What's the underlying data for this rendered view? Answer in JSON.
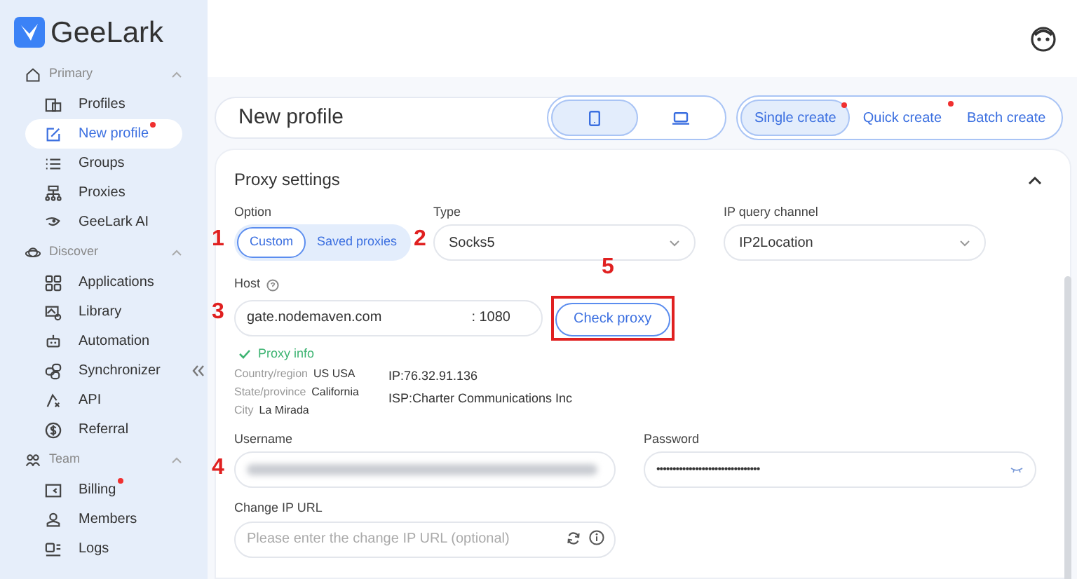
{
  "app": {
    "name": "GeeLark"
  },
  "sidebar": {
    "sections": [
      {
        "title": "Primary",
        "expanded": true,
        "items": [
          {
            "label": "Profiles",
            "selected": false,
            "dot": false
          },
          {
            "label": "New profile",
            "selected": true,
            "dot": true
          },
          {
            "label": "Groups",
            "selected": false,
            "dot": false
          },
          {
            "label": "Proxies",
            "selected": false,
            "dot": false
          },
          {
            "label": "GeeLark AI",
            "selected": false,
            "dot": false
          }
        ]
      },
      {
        "title": "Discover",
        "expanded": true,
        "items": [
          {
            "label": "Applications",
            "selected": false,
            "dot": false
          },
          {
            "label": "Library",
            "selected": false,
            "dot": false
          },
          {
            "label": "Automation",
            "selected": false,
            "dot": false
          },
          {
            "label": "Synchronizer",
            "selected": false,
            "dot": false
          },
          {
            "label": "API",
            "selected": false,
            "dot": false
          },
          {
            "label": "Referral",
            "selected": false,
            "dot": false
          }
        ]
      },
      {
        "title": "Team",
        "expanded": true,
        "items": [
          {
            "label": "Billing",
            "selected": false,
            "dot": true
          },
          {
            "label": "Members",
            "selected": false,
            "dot": false
          },
          {
            "label": "Logs",
            "selected": false,
            "dot": false
          }
        ]
      }
    ]
  },
  "header": {
    "title": "New profile",
    "devices": [
      {
        "kind": "phone",
        "selected": true
      },
      {
        "kind": "laptop",
        "selected": false
      }
    ],
    "modes": [
      {
        "label": "Single create",
        "selected": true,
        "dot": true
      },
      {
        "label": "Quick create",
        "selected": false,
        "dot": true
      },
      {
        "label": "Batch create",
        "selected": false,
        "dot": false
      }
    ]
  },
  "proxy_settings": {
    "title": "Proxy settings",
    "expanded": true,
    "option": {
      "label": "Option",
      "choices": [
        {
          "label": "Custom",
          "selected": true
        },
        {
          "label": "Saved proxies",
          "selected": false
        }
      ]
    },
    "type": {
      "label": "Type",
      "value": "Socks5"
    },
    "ip_query_channel": {
      "label": "IP query channel",
      "value": "IP2Location"
    },
    "host": {
      "label": "Host",
      "value": "gate.nodemaven.com",
      "port": ": 1080"
    },
    "check_button": "Check proxy",
    "proxy_info": {
      "title": "Proxy info",
      "rows": [
        {
          "label": "Country/region",
          "value": "US USA"
        },
        {
          "label": "State/province",
          "value": "California"
        },
        {
          "label": "City",
          "value": "La Mirada"
        }
      ],
      "ip": "IP:76.32.91.136",
      "isp": "ISP:Charter Communications Inc"
    },
    "username": {
      "label": "Username",
      "redacted": true
    },
    "password": {
      "label": "Password",
      "value": "••••••••••••••••••••••••••••••••"
    },
    "change_ip_url": {
      "label": "Change IP URL",
      "placeholder": "Please enter the change IP URL (optional)"
    }
  },
  "annotations": [
    "1",
    "2",
    "3",
    "4",
    "5"
  ]
}
